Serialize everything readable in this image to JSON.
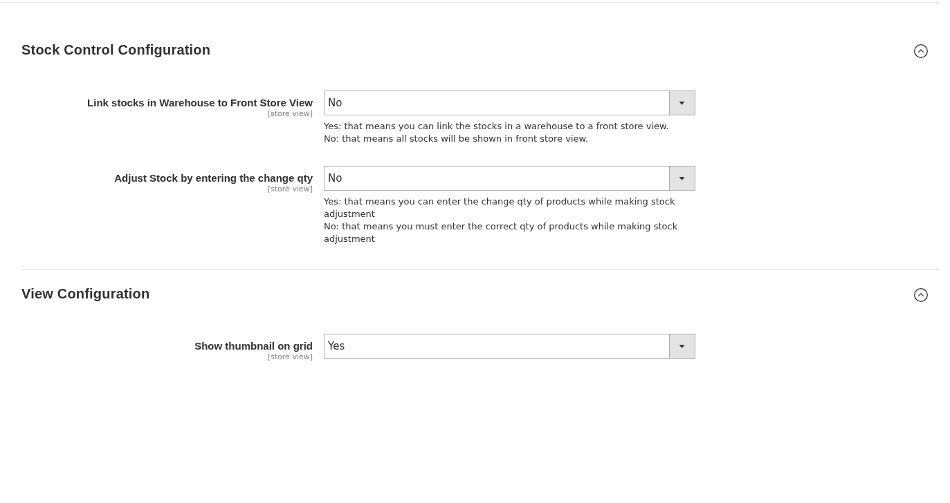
{
  "sections": [
    {
      "title": "Stock Control Configuration",
      "expanded": true,
      "fields": [
        {
          "label": "Link stocks in Warehouse to Front Store View",
          "scope": "[store view]",
          "value": "No",
          "notes": [
            "Yes: that means you can link the stocks in a warehouse to a front store view.",
            "No: that means all stocks will be shown in front store view."
          ]
        },
        {
          "label": "Adjust Stock by entering the change qty",
          "scope": "[store view]",
          "value": "No",
          "notes": [
            "Yes: that means you can enter the change qty of products while making stock adjustment",
            "No: that means you must enter the correct qty of products while making stock adjustment"
          ]
        }
      ]
    },
    {
      "title": "View Configuration",
      "expanded": true,
      "fields": [
        {
          "label": "Show thumbnail on grid",
          "scope": "[store view]",
          "value": "Yes"
        }
      ]
    }
  ]
}
